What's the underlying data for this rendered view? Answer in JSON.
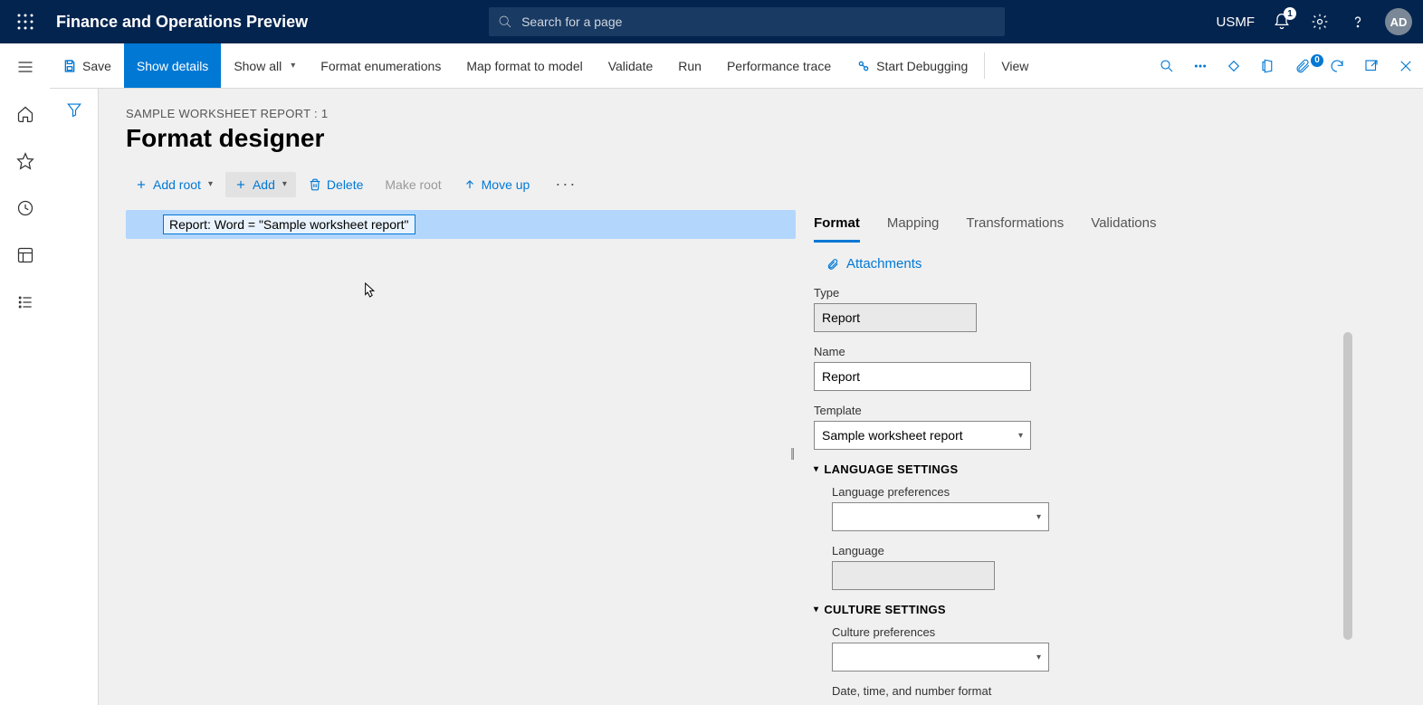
{
  "top": {
    "app_title": "Finance and Operations Preview",
    "search_placeholder": "Search for a page",
    "company": "USMF",
    "notif_count": "1",
    "doc_badge": "0",
    "avatar": "AD"
  },
  "cmd": {
    "save": "Save",
    "show_details": "Show details",
    "show_all": "Show all",
    "format_enum": "Format enumerations",
    "map_format": "Map format to model",
    "validate": "Validate",
    "run": "Run",
    "perf": "Performance trace",
    "start_debug": "Start Debugging",
    "view": "View"
  },
  "page": {
    "breadcrumb": "SAMPLE WORKSHEET REPORT : 1",
    "title": "Format designer"
  },
  "tree_toolbar": {
    "add_root": "Add root",
    "add": "Add",
    "delete": "Delete",
    "make_root": "Make root",
    "move_up": "Move up"
  },
  "tree": {
    "node0": "Report: Word = \"Sample worksheet report\""
  },
  "tabs": {
    "format": "Format",
    "mapping": "Mapping",
    "transformations": "Transformations",
    "validations": "Validations"
  },
  "attachments": "Attachments",
  "fields": {
    "type_label": "Type",
    "type_value": "Report",
    "name_label": "Name",
    "name_value": "Report",
    "template_label": "Template",
    "template_value": "Sample worksheet report",
    "lang_section": "LANGUAGE SETTINGS",
    "lang_pref_label": "Language preferences",
    "lang_pref_value": "",
    "lang_label": "Language",
    "lang_value": "",
    "culture_section": "CULTURE SETTINGS",
    "culture_pref_label": "Culture preferences",
    "culture_pref_value": "",
    "dtf_label": "Date, time, and number format"
  }
}
